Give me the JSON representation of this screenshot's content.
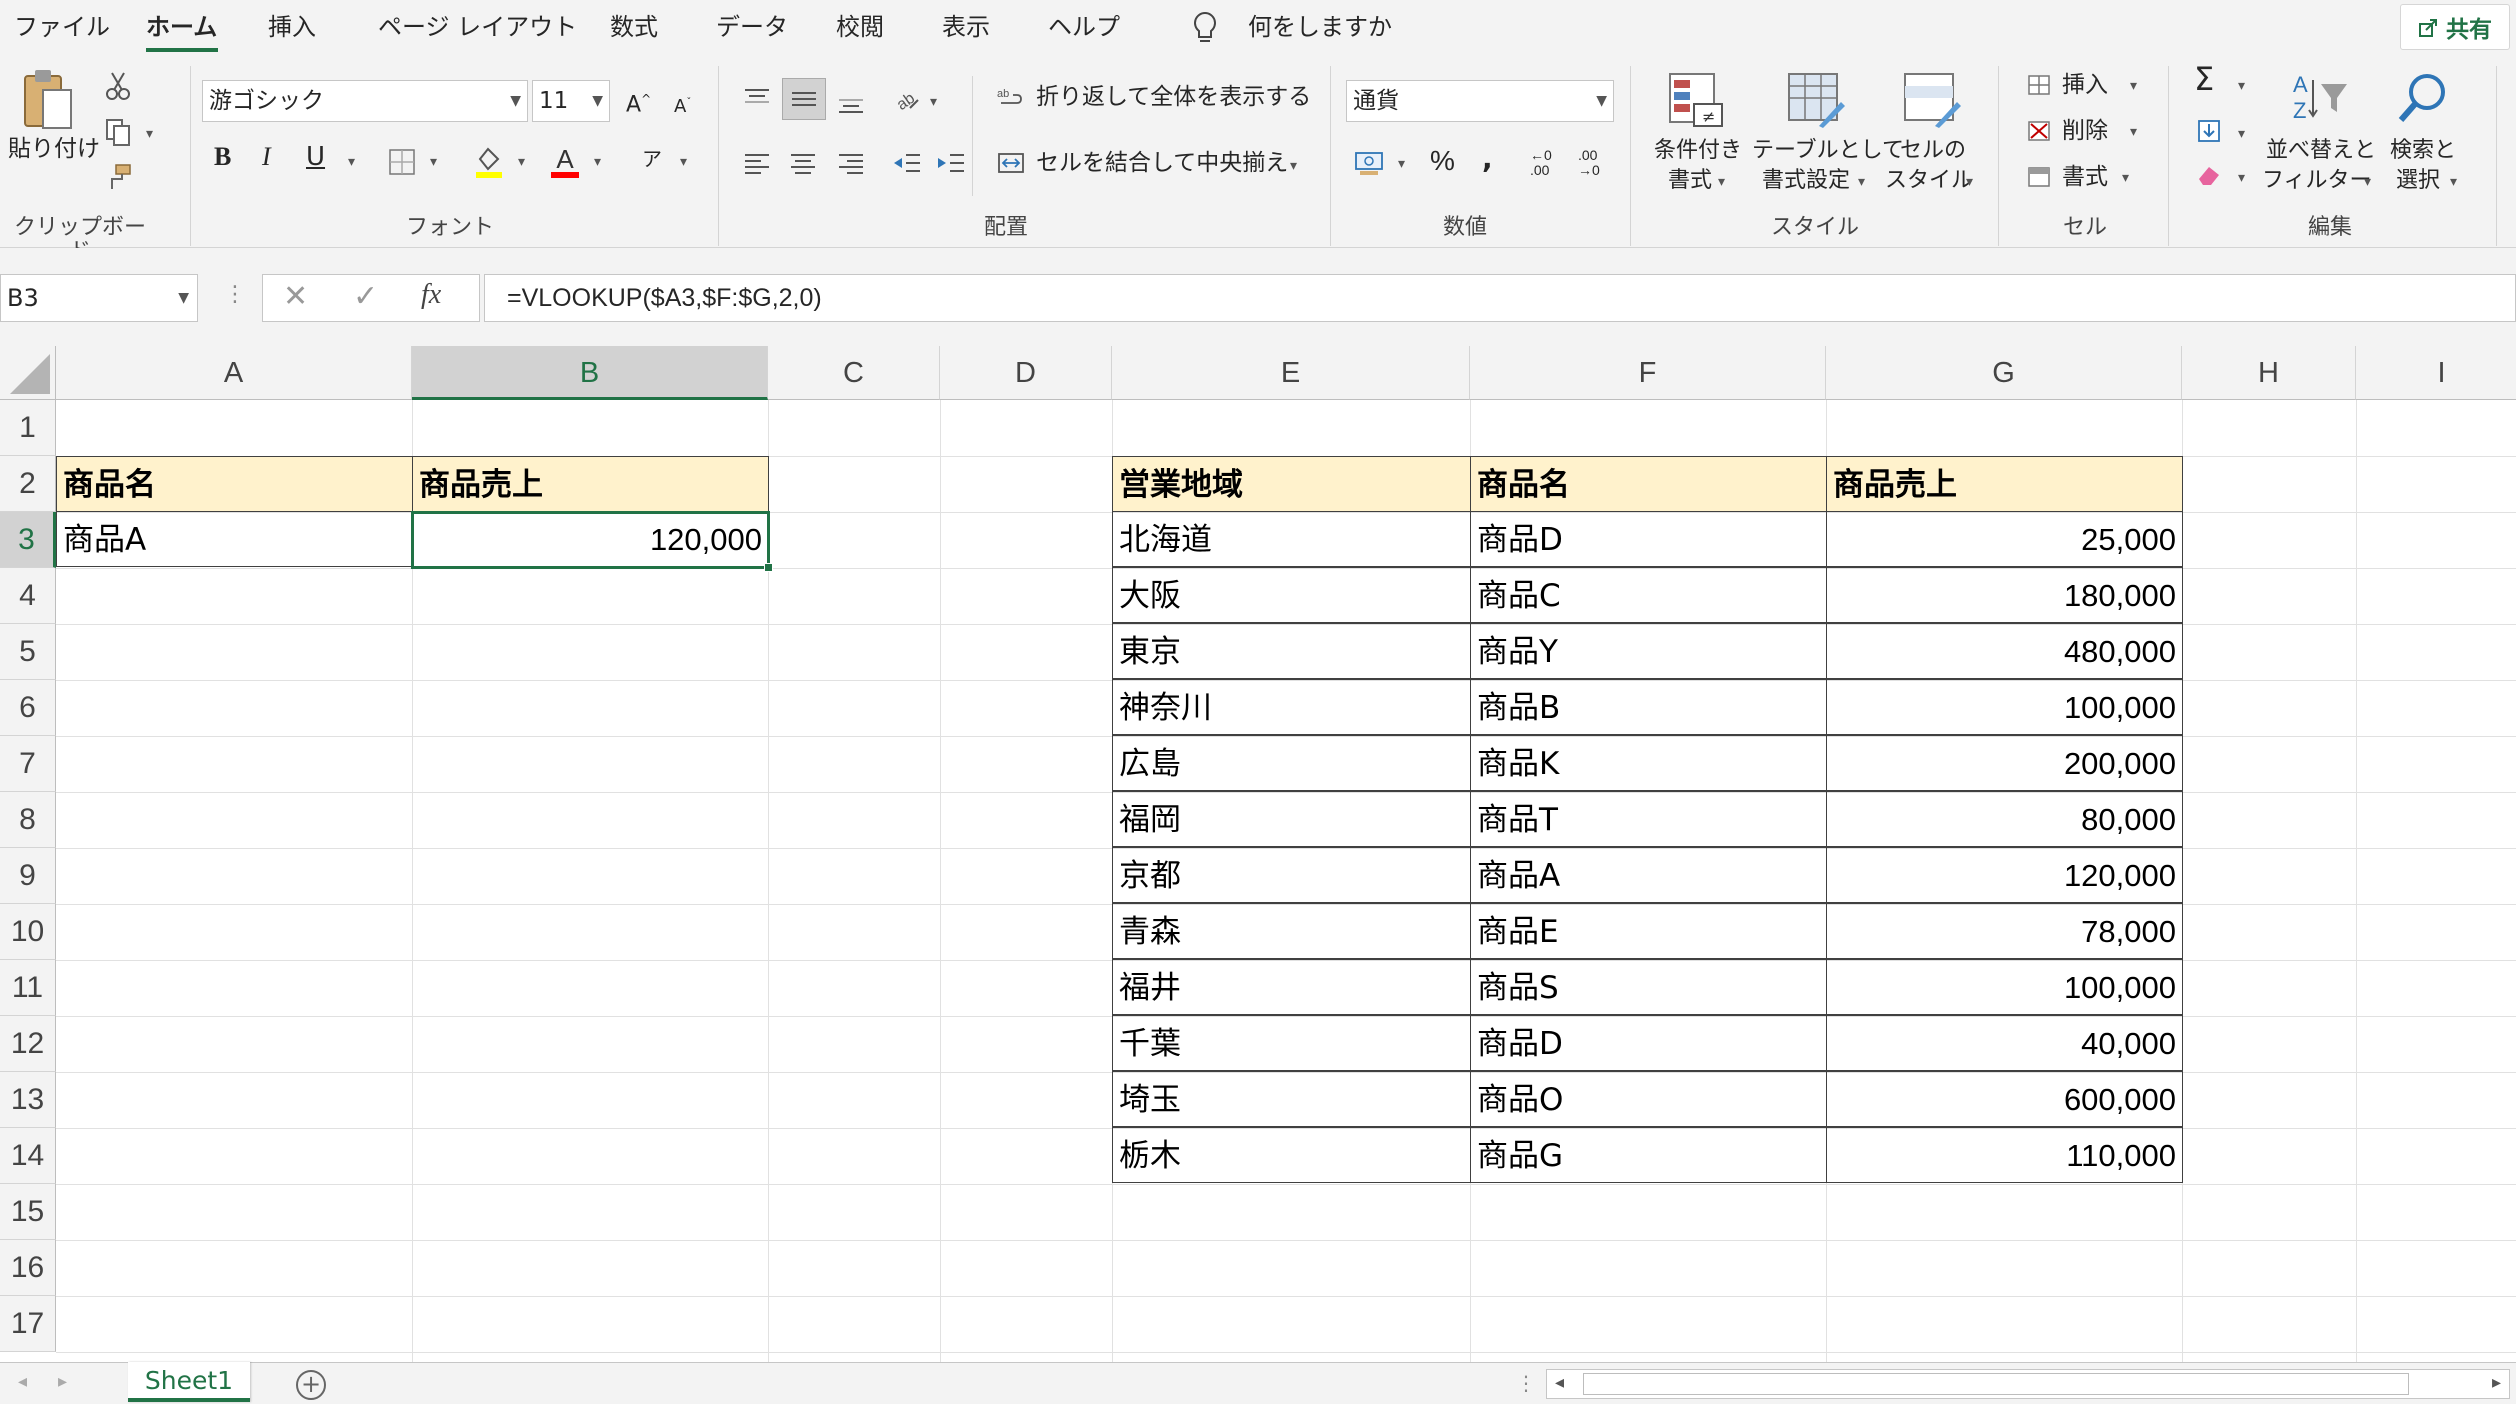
{
  "menu": {
    "tabs": [
      "ファイル",
      "ホーム",
      "挿入",
      "ページ レイアウト",
      "数式",
      "データ",
      "校閲",
      "表示",
      "ヘルプ"
    ],
    "active_tab": "ホーム",
    "tell_me": "何をしますか",
    "share": "共有"
  },
  "ribbon": {
    "clipboard": {
      "paste": "貼り付け",
      "label": "クリップボード"
    },
    "font": {
      "name": "游ゴシック",
      "size": "11",
      "label": "フォント"
    },
    "alignment": {
      "wrap_text": "折り返して全体を表示する",
      "merge_center": "セルを結合して中央揃え",
      "label": "配置"
    },
    "number": {
      "format": "通貨",
      "label": "数値"
    },
    "styles": {
      "conditional": [
        "条件付き",
        "書式"
      ],
      "format_table": [
        "テーブルとして",
        "書式設定"
      ],
      "cell_styles": [
        "セルの",
        "スタイル"
      ],
      "label": "スタイル"
    },
    "cells": {
      "insert": "挿入",
      "delete": "削除",
      "format": "書式",
      "label": "セル"
    },
    "editing": {
      "sort_filter": [
        "並べ替えと",
        "フィルター"
      ],
      "find_select": [
        "検索と",
        "選択"
      ],
      "label": "編集"
    }
  },
  "formula_bar": {
    "name_box": "B3",
    "formula": "=VLOOKUP($A3,$F:$G,2,0)"
  },
  "sheet": {
    "columns": [
      "A",
      "B",
      "C",
      "D",
      "E",
      "F",
      "G",
      "H",
      "I"
    ],
    "rows": [
      "1",
      "2",
      "3",
      "4",
      "5",
      "6",
      "7",
      "8",
      "9",
      "10",
      "11",
      "12",
      "13",
      "14",
      "15",
      "16",
      "17"
    ],
    "lookup": {
      "header_name": "商品名",
      "header_sales": "商品売上",
      "name": "商品A",
      "sales": "120,000"
    },
    "table": {
      "headers": [
        "営業地域",
        "商品名",
        "商品売上"
      ],
      "rows": [
        [
          "北海道",
          "商品D",
          "25,000"
        ],
        [
          "大阪",
          "商品C",
          "180,000"
        ],
        [
          "東京",
          "商品Y",
          "480,000"
        ],
        [
          "神奈川",
          "商品B",
          "100,000"
        ],
        [
          "広島",
          "商品K",
          "200,000"
        ],
        [
          "福岡",
          "商品T",
          "80,000"
        ],
        [
          "京都",
          "商品A",
          "120,000"
        ],
        [
          "青森",
          "商品E",
          "78,000"
        ],
        [
          "福井",
          "商品S",
          "100,000"
        ],
        [
          "千葉",
          "商品D",
          "40,000"
        ],
        [
          "埼玉",
          "商品O",
          "600,000"
        ],
        [
          "栃木",
          "商品G",
          "110,000"
        ]
      ]
    }
  },
  "bottom": {
    "sheet_tab": "Sheet1"
  },
  "colors": {
    "accent": "#217346",
    "header_fill": "#fff2cc",
    "font_red": "#ff0000"
  }
}
